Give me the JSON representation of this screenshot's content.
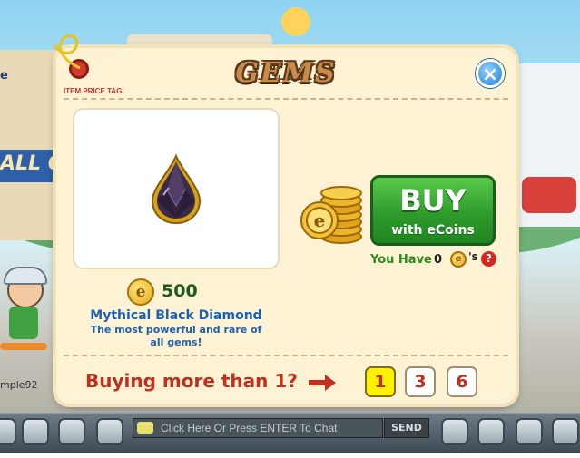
{
  "modal": {
    "title": "GEMS",
    "price_tag_label": "ITEM PRICE TAG!",
    "close_label": "×",
    "item": {
      "name": "Mythical Black Diamond",
      "description": "The most powerful and rare of all gems!",
      "price": "500",
      "currency_icon": "ecoin-icon"
    },
    "buy": {
      "title": "BUY",
      "subtitle": "with eCoins"
    },
    "balance": {
      "label": "You Have",
      "count": "0",
      "suffix": "'s",
      "help": "?"
    },
    "quantity": {
      "prompt": "Buying more than 1?",
      "options": [
        "1",
        "3",
        "6"
      ],
      "selected": "1"
    }
  },
  "background": {
    "side_text_left": "ALL OF",
    "username_partial": "mple92",
    "chat_placeholder": "Click Here Or Press ENTER To Chat",
    "send_label": "SEND",
    "left_edge_letter": "e"
  },
  "colors": {
    "buy_green": "#2f9b2d",
    "price_green": "#1e5b1e",
    "name_blue": "#1f5fb0",
    "quantity_red": "#c0301f",
    "selected_yellow": "#fff200",
    "panel_cream": "#fdf2d4"
  }
}
